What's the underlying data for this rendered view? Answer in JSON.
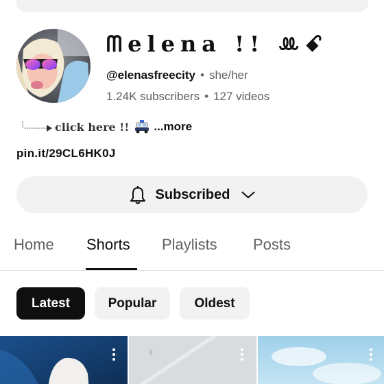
{
  "channel": {
    "name": "ᗰelena !! ꔛꗃ",
    "handle": "@elenasfreecity",
    "pronouns": "she/her",
    "subscribers": "1.24K subscribers",
    "videos": "127 videos",
    "separator": "•"
  },
  "description": {
    "text": "click here !!",
    "more_label": "...more"
  },
  "link": "pin.it/29CL6HK0J",
  "subscribe": {
    "label": "Subscribed"
  },
  "tabs": [
    {
      "label": "Home"
    },
    {
      "label": "Shorts"
    },
    {
      "label": "Playlists"
    },
    {
      "label": "Posts"
    }
  ],
  "active_tab": "Shorts",
  "filters": [
    {
      "label": "Latest"
    },
    {
      "label": "Popular"
    },
    {
      "label": "Oldest"
    }
  ],
  "active_filter": "Latest",
  "icons": {
    "bell": "bell-icon",
    "chevron": "chevron-down-icon",
    "more": "more-vert-icon",
    "car": "police-car-icon"
  },
  "colors": {
    "text": "#0f0f0f",
    "secondary_text": "#606060",
    "chip_bg": "#f2f2f2",
    "chip_active_bg": "#0f0f0f"
  }
}
